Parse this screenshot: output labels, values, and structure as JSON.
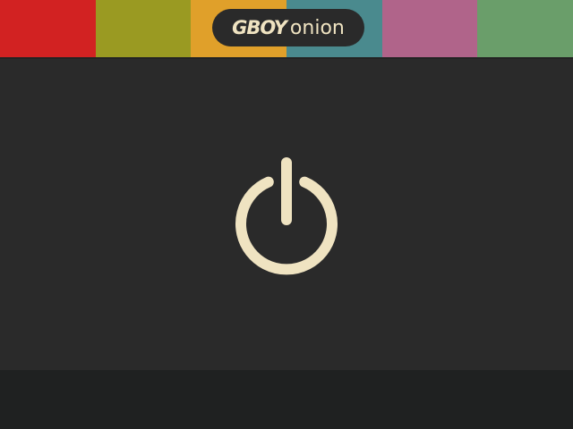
{
  "header": {
    "stripes": [
      {
        "name": "red",
        "color": "#d22222"
      },
      {
        "name": "olive",
        "color": "#9a9a22"
      },
      {
        "name": "orange",
        "color": "#e0a02a"
      },
      {
        "name": "teal",
        "color": "#4a8a8e"
      },
      {
        "name": "pink",
        "color": "#b0648a"
      },
      {
        "name": "green",
        "color": "#6a9e6a"
      }
    ],
    "logo": {
      "brand": "GBOY",
      "product": "onion"
    }
  },
  "power": {
    "icon": "power-icon",
    "color": "#efe3c1"
  },
  "colors": {
    "main_background": "#2a2a2a",
    "bottom_bar": "#1f2121"
  }
}
